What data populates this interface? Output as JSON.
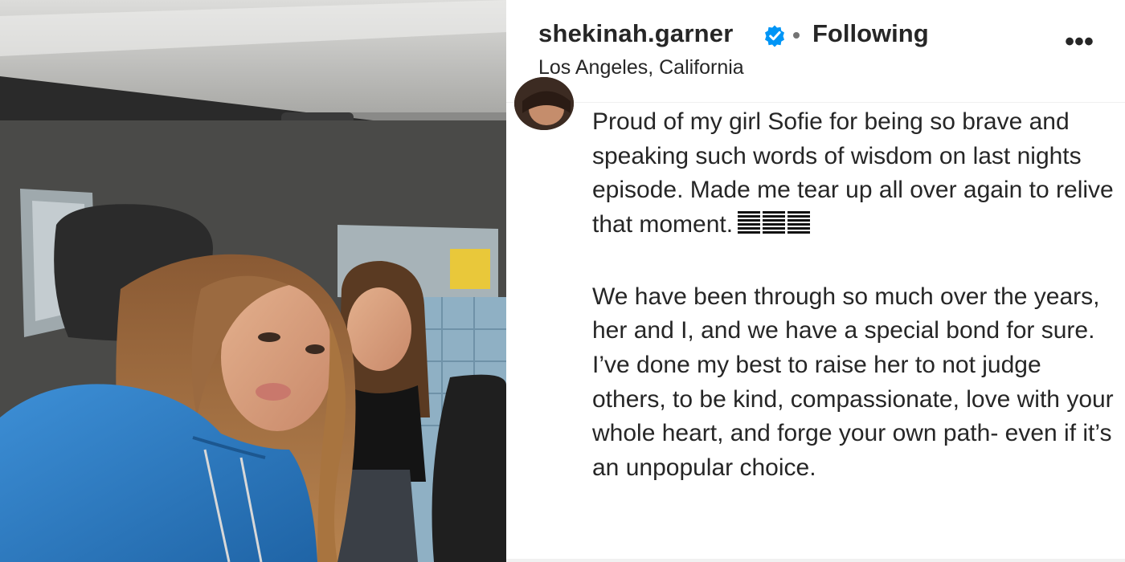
{
  "post": {
    "username": "shekinah.garner",
    "verified_icon": "verified-badge-icon",
    "follow_status": "Following",
    "location": "Los Angeles, California",
    "more_icon": "more-options-icon",
    "more_label": "•••",
    "caption_paragraph_1": "Proud of my girl Sofie for being so brave and speaking such words of wisdom on last nights episode. Made me tear up all over again to relive that moment.",
    "caption_emoji_count": 3,
    "caption_paragraph_2": "We have been through so much over the years, her and I, and we have a special bond for sure. I’ve done my best to raise her to not judge others, to be kind, compassionate, love with your whole heart, and forge your own path- even if it’s an unpopular choice."
  },
  "colors": {
    "text": "#262626",
    "verified_blue": "#0095f6",
    "secondary": "#737373",
    "hoodie_blue": "#2f7fc4"
  }
}
